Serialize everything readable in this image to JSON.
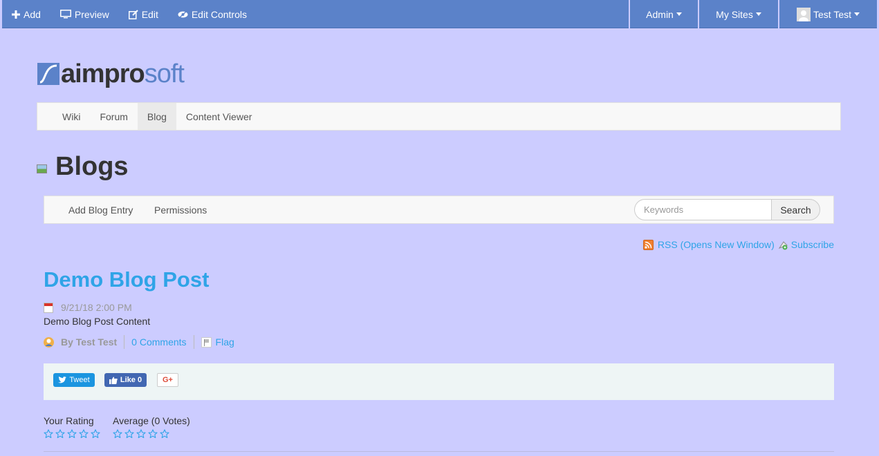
{
  "dockbar": {
    "add_label": "Add",
    "preview_label": "Preview",
    "edit_label": "Edit",
    "edit_controls_label": "Edit Controls",
    "admin_label": "Admin",
    "my_sites_label": "My Sites",
    "user_label": "Test Test"
  },
  "logo": {
    "part1": "aimpro",
    "part2": "soft"
  },
  "sitenav": {
    "items": [
      {
        "label": "Wiki"
      },
      {
        "label": "Forum"
      },
      {
        "label": "Blog",
        "active": true
      },
      {
        "label": "Content Viewer"
      }
    ]
  },
  "page": {
    "title": "Blogs"
  },
  "blog_toolbar": {
    "add_entry_label": "Add Blog Entry",
    "permissions_label": "Permissions",
    "search_placeholder": "Keywords",
    "search_button": "Search"
  },
  "feeds": {
    "rss_label": "RSS (Opens New Window)",
    "subscribe_label": "Subscribe"
  },
  "entry": {
    "title": "Demo Blog Post",
    "date": "9/21/18 2:00 PM",
    "content": "Demo Blog Post Content",
    "author": "By Test Test",
    "comments": "0 Comments",
    "flag": "Flag"
  },
  "social": {
    "tweet_label": "Tweet",
    "like_label": "Like 0",
    "gplus_label": "G+"
  },
  "ratings": {
    "your_rating_label": "Your Rating",
    "average_label": "Average (0 Votes)",
    "your_rating_value": 0,
    "average_value": 0,
    "max": 5
  },
  "colors": {
    "dockbar": "#5b82c9",
    "background": "#ccccff",
    "link": "#2fa4e7"
  }
}
